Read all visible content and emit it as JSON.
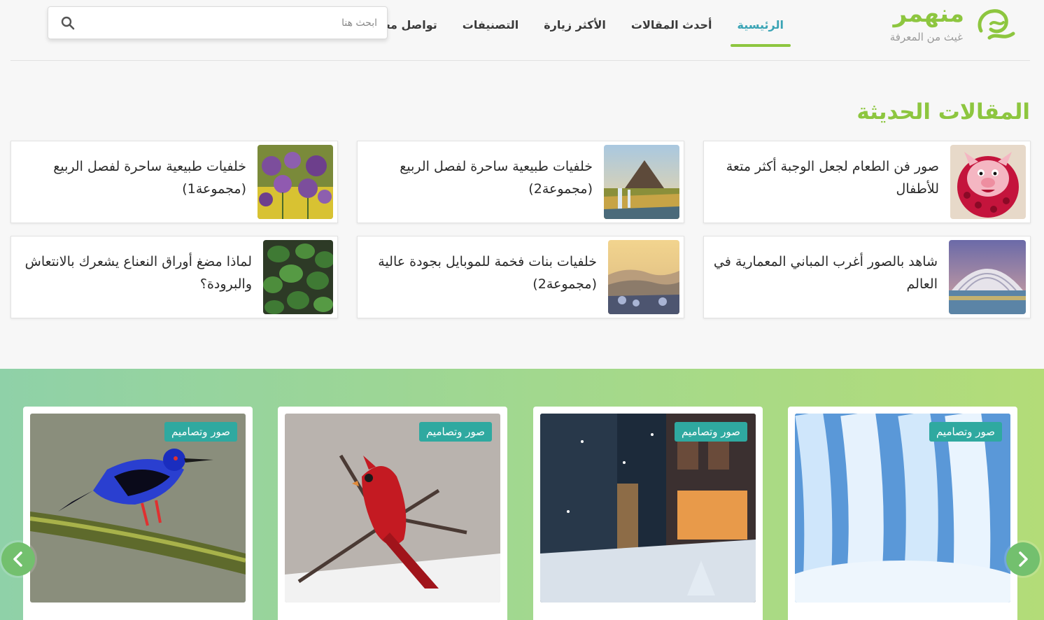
{
  "brand": {
    "name": "منهمر",
    "tagline": "غيث من المعرفة",
    "accent": "#8dc63f",
    "teal": "#3aa4b5"
  },
  "nav": {
    "items": [
      {
        "label": "الرئيسية",
        "active": true
      },
      {
        "label": "أحدث المقالات",
        "active": false
      },
      {
        "label": "الأكثر زيارة",
        "active": false
      },
      {
        "label": "التصنيفات",
        "active": false
      },
      {
        "label": "تواصل معنا",
        "active": false
      }
    ]
  },
  "search": {
    "placeholder": "ابحث هنا",
    "icon": "search-icon"
  },
  "recent": {
    "title": "المقالات الحديثة",
    "articles": [
      {
        "title": "صور فن الطعام لجعل الوجبة أكثر متعة للأطفال",
        "thumb": "food-art"
      },
      {
        "title": "خلفيات طبيعية ساحرة لفصل الربيع (مجموعة2)",
        "thumb": "mountain-waterfall"
      },
      {
        "title": "خلفيات طبيعية ساحرة لفصل الربيع (مجموعة1)",
        "thumb": "purple-flowers"
      },
      {
        "title": "شاهد بالصور أغرب المباني المعمارية في العالم",
        "thumb": "futuristic-building"
      },
      {
        "title": "خلفيات بنات فخمة للموبايل بجودة عالية (مجموعة2)",
        "thumb": "misty-hills"
      },
      {
        "title": "لماذا مضغ أوراق النعناع يشعرك بالانتعاش والبرودة؟",
        "thumb": "mint-leaves"
      }
    ]
  },
  "carousel": {
    "slides": [
      {
        "category": "صور وتصاميم",
        "image": "frozen-waterfall"
      },
      {
        "category": "صور وتصاميم",
        "image": "snowy-street"
      },
      {
        "category": "صور وتصاميم",
        "image": "red-cardinal"
      },
      {
        "category": "صور وتصاميم",
        "image": "blue-bird"
      }
    ],
    "prev_icon": "chevron-left-icon",
    "next_icon": "chevron-right-icon"
  }
}
